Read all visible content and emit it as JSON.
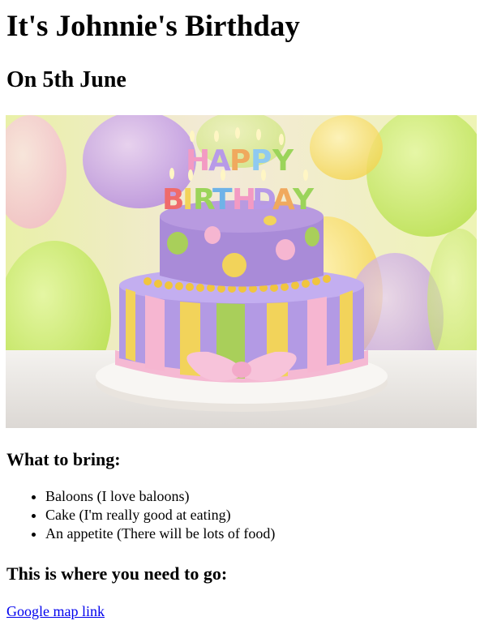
{
  "heading": {
    "title": "It's Johnnie's Birthday",
    "date": "On 5th June"
  },
  "image": {
    "icon": "birthday-cake-image",
    "cake_text_top": "HAPPY",
    "cake_text_bottom": "BIRTHDAY",
    "colors": {
      "background": "#f3f0e8",
      "cake_top": "#a98bd8",
      "cake_bottom": "#b7a0e6",
      "stripe_yellow": "#f2d35a",
      "stripe_green": "#a9cf5a",
      "stripe_pink": "#f6b3cf",
      "ribbon": "#f7bfd7",
      "plate": "#f5f2ee"
    }
  },
  "bring": {
    "heading": "What to bring:",
    "items": [
      "Baloons (I love baloons)",
      "Cake (I'm really good at eating)",
      "An appetite (There will be lots of food)"
    ]
  },
  "go": {
    "heading": "This is where you need to go:",
    "link_label": "Google map link"
  }
}
